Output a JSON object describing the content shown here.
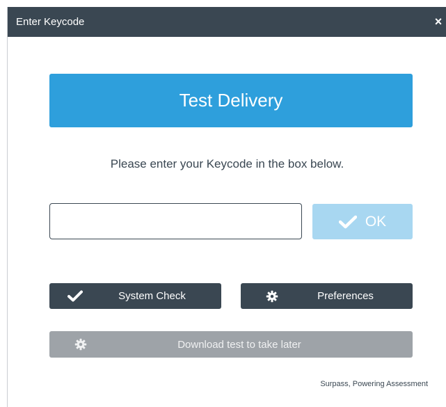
{
  "window": {
    "title": "Enter Keycode",
    "close_glyph": "×"
  },
  "banner": {
    "title": "Test Delivery"
  },
  "instruction": "Please enter your Keycode in the box below.",
  "keycode_input": {
    "value": "",
    "placeholder": ""
  },
  "ok_button": {
    "label": "OK",
    "icon": "checkmark-icon"
  },
  "buttons": {
    "system_check": {
      "label": "System Check",
      "icon": "checkmark-icon"
    },
    "preferences": {
      "label": "Preferences",
      "icon": "gear-icon"
    },
    "download": {
      "label": "Download test to take later",
      "icon": "gear-icon"
    }
  },
  "footer": "Surpass, Powering Assessment",
  "colors": {
    "titlebar": "#3a4752",
    "banner": "#2e9fdc",
    "ok_disabled": "#a8d7f1",
    "dark_button": "#3a4752",
    "disabled_button": "#9ea3a8"
  }
}
